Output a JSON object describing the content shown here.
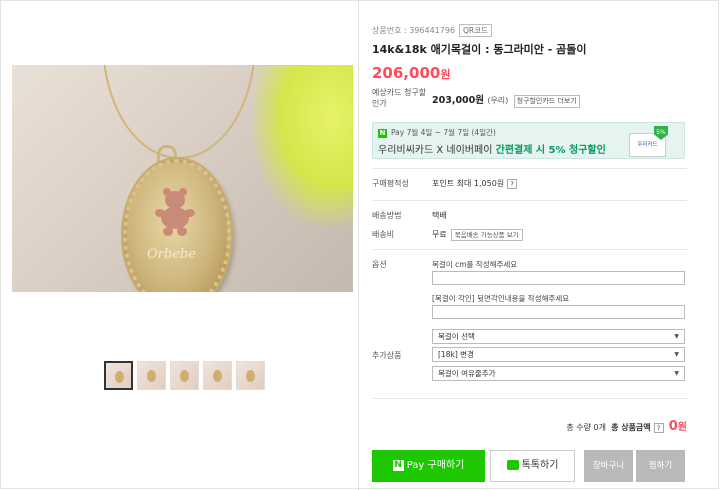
{
  "product": {
    "number_label": "상품번호 : 396441796",
    "qr_label": "QR코드",
    "title": "14k&18k 애기목걸이 : 동그라미안 - 곰돌이",
    "price": "206,000",
    "price_unit": "원",
    "card_discount_label": "예상카드 청구할인가",
    "card_price": "203,000원",
    "card_note": "(우리)",
    "card_more_button": "청구할인카드 더보기",
    "engraving_text": "Orbebe"
  },
  "banner": {
    "badge": "N",
    "top_text": "Pay 7월 4일 ~ 7월 7일 (4일간)",
    "main_text": "우리비씨카드 X 네이버페이 ",
    "highlight_text": "간편결제 시 5% 청구할인",
    "card_name": "우리카드",
    "percent": "5%"
  },
  "info": {
    "points_label": "구매평적성",
    "points_value": "포인트 최대 1,050원",
    "shipping_method_label": "배송방법",
    "shipping_method_value": "택배",
    "shipping_fee_label": "배송비",
    "shipping_fee_value": "무료",
    "bundle_button": "묶음배송 가능상품 보기"
  },
  "options": {
    "label": "옵션",
    "field1_label": "목걸이 cm를 작성해주세요",
    "field2_label": "[목걸이 각인] 뒷면각인내용을 작성해주세요",
    "additional_label": "추가상품",
    "select1": "목걸이 선택",
    "select2": "[18k] 변경",
    "select3": "목걸이 여유줄추가"
  },
  "total": {
    "qty_text": "총 수량 0개",
    "amount_label": "총 상품금액",
    "amount_value": "0",
    "amount_unit": "원"
  },
  "buttons": {
    "npay": "Pay 구매하기",
    "npay_badge": "N",
    "talk": "톡톡하기",
    "cart": "장바구니",
    "wish": "찜하기"
  },
  "colors": {
    "price_red": "#ff4b5c",
    "naver_green": "#1ec800"
  }
}
